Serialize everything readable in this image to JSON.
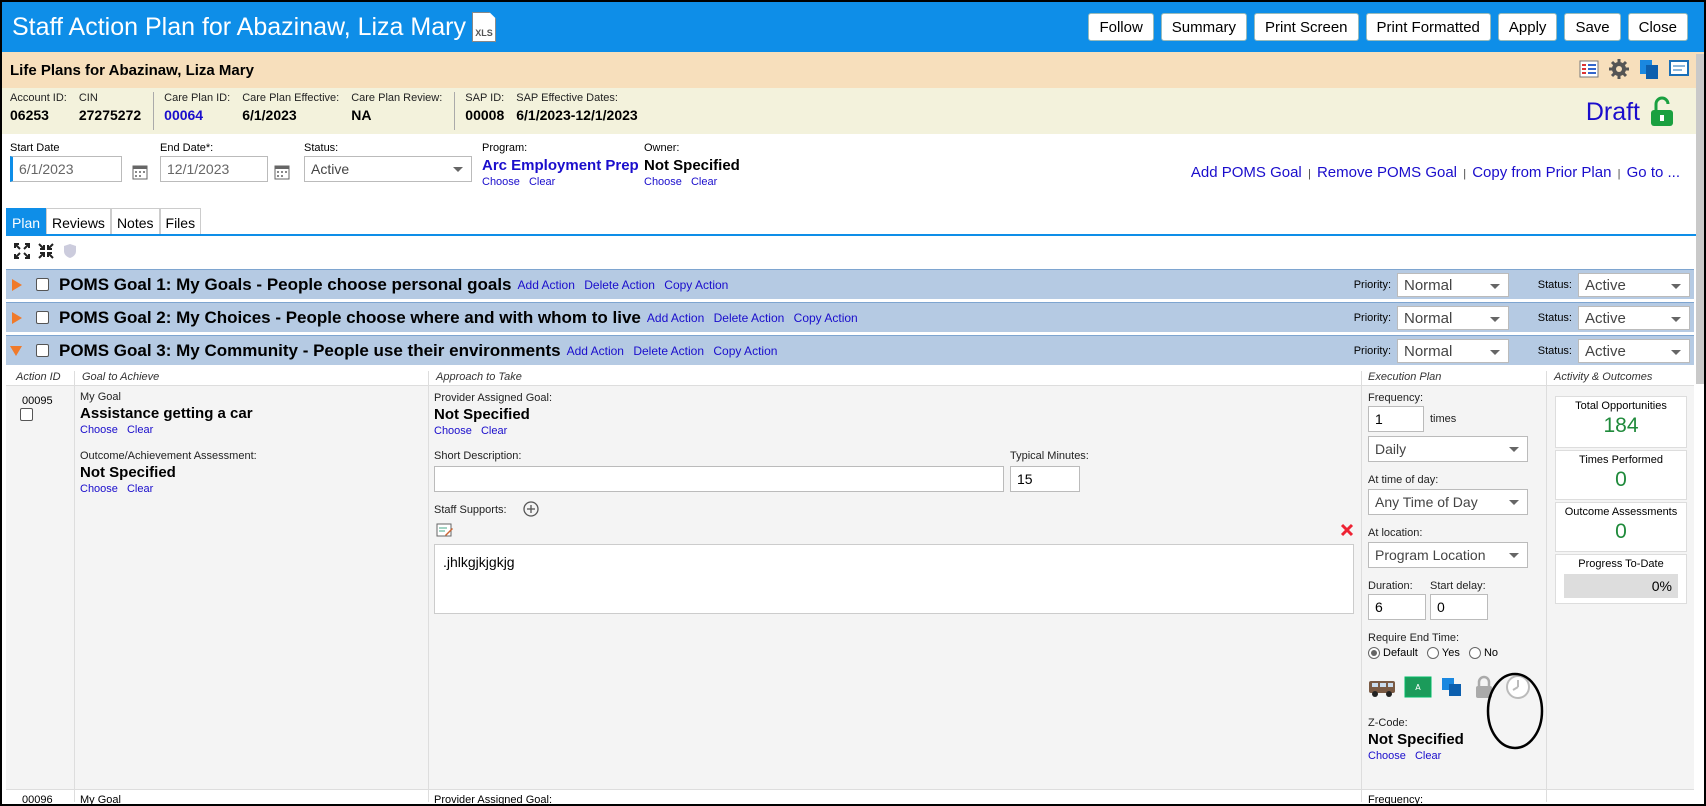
{
  "title": "Staff Action Plan for Abazinaw, Liza Mary",
  "xls_label": "XLS",
  "toolbar": {
    "follow": "Follow",
    "summary": "Summary",
    "print_screen": "Print Screen",
    "print_formatted": "Print Formatted",
    "apply": "Apply",
    "save": "Save",
    "close": "Close"
  },
  "life_plans_title": "Life Plans for Abazinaw, Liza Mary",
  "info": {
    "account_id_label": "Account ID:",
    "account_id": "06253",
    "cin_label": "CIN",
    "cin": "27275272",
    "care_plan_id_label": "Care Plan ID:",
    "care_plan_id": "00064",
    "care_plan_effective_label": "Care Plan Effective:",
    "care_plan_effective": "6/1/2023",
    "care_plan_review_label": "Care Plan Review:",
    "care_plan_review": "NA",
    "sap_id_label": "SAP ID:",
    "sap_id": "00008",
    "sap_dates_label": "SAP Effective Dates:",
    "sap_dates": "6/1/2023-12/1/2023",
    "draft": "Draft"
  },
  "filters": {
    "start_date_label": "Start Date",
    "start_date": "6/1/2023",
    "end_date_label": "End Date*:",
    "end_date": "12/1/2023",
    "status_label": "Status:",
    "status": "Active",
    "program_label": "Program:",
    "program": "Arc Employment Prep",
    "owner_label": "Owner:",
    "owner": "Not Specified",
    "choose": "Choose",
    "clear": "Clear"
  },
  "top_links": {
    "add": "Add POMS Goal",
    "remove": "Remove POMS Goal",
    "copy_prior": "Copy from Prior Plan",
    "goto": "Go to ...",
    "pipe": "|"
  },
  "tabs": [
    "Plan",
    "Reviews",
    "Notes",
    "Files"
  ],
  "goals": [
    {
      "title": "POMS Goal 1: My Goals - People choose personal goals",
      "priority": "Normal",
      "status": "Active"
    },
    {
      "title": "POMS Goal 2: My Choices - People choose where and with whom to live",
      "priority": "Normal",
      "status": "Active"
    },
    {
      "title": "POMS Goal 3: My Community - People use their environments",
      "priority": "Normal",
      "status": "Active"
    }
  ],
  "goal_actions": {
    "add": "Add Action",
    "delete": "Delete Action",
    "copy": "Copy Action"
  },
  "priority_label": "Priority:",
  "status_label": "Status:",
  "columns": {
    "action_id": "Action ID",
    "goal": "Goal to Achieve",
    "approach": "Approach to Take",
    "execution": "Execution Plan",
    "activity": "Activity & Outcomes"
  },
  "action": {
    "id": "00095",
    "my_goal_label": "My Goal",
    "my_goal": "Assistance getting a car",
    "outcome_label": "Outcome/Achievement Assessment:",
    "outcome": "Not Specified",
    "provider_label": "Provider Assigned Goal:",
    "provider": "Not Specified",
    "short_desc_label": "Short Description:",
    "short_desc": "",
    "typical_minutes_label": "Typical Minutes:",
    "typical_minutes": "15",
    "staff_supports_label": "Staff Supports:",
    "staff_supports_text": ".jhlkgjkjgkjg",
    "frequency_label": "Frequency:",
    "frequency": "1",
    "times": "times",
    "period": "Daily",
    "time_of_day_label": "At time of day:",
    "time_of_day": "Any Time of Day",
    "location_label": "At location:",
    "location": "Program Location",
    "duration_label": "Duration:",
    "duration": "6",
    "start_delay_label": "Start delay:",
    "start_delay": "0",
    "require_end_label": "Require End Time:",
    "req_default": "Default",
    "req_yes": "Yes",
    "req_no": "No",
    "zcode_label": "Z-Code:",
    "zcode": "Not Specified",
    "total_opp_label": "Total Opportunities",
    "total_opp": "184",
    "times_performed_label": "Times Performed",
    "times_performed": "0",
    "outcome_assess_label": "Outcome Assessments",
    "outcome_assess": "0",
    "progress_label": "Progress To-Date",
    "progress": "0%"
  },
  "next_action": {
    "id": "00096",
    "my_goal_label": "My Goal",
    "provider_label": "Provider Assigned Goal:",
    "frequency_label": "Frequency:"
  }
}
